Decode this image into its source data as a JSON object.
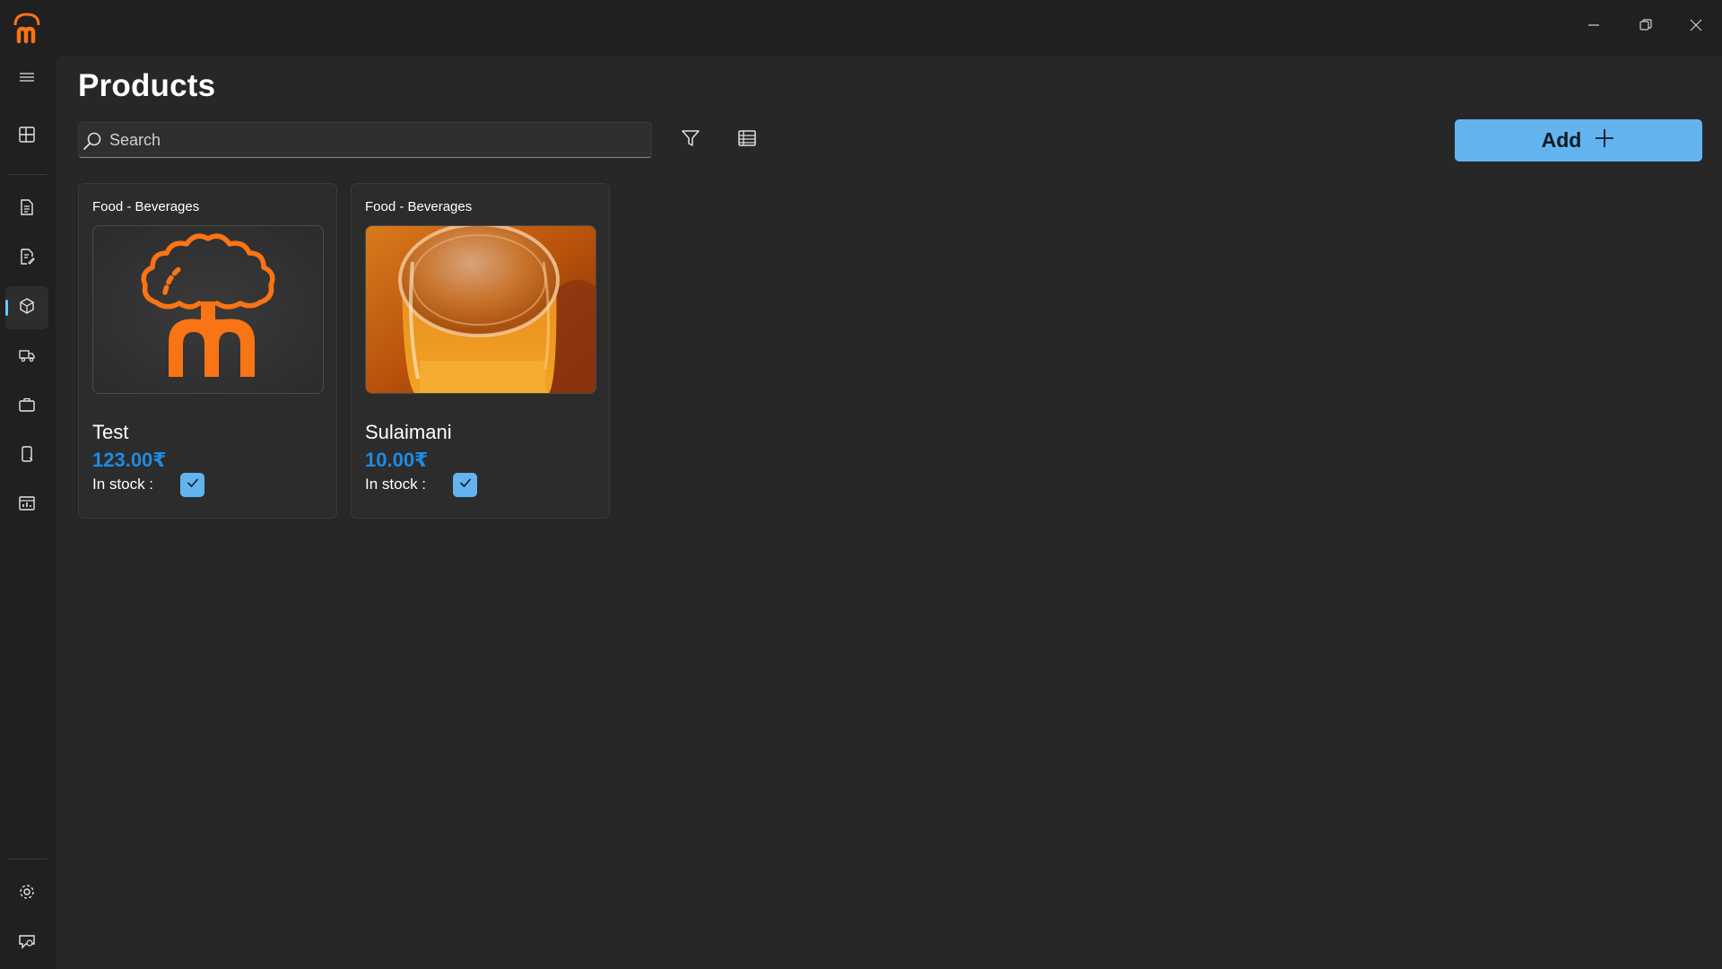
{
  "window": {
    "logo": "app-logo-icon",
    "controls": [
      "minimize-icon",
      "restore-icon",
      "close-icon"
    ]
  },
  "sidebar": {
    "items": [
      {
        "icon": "hamburger-menu-icon"
      },
      {
        "icon": "dashboard-icon"
      },
      {
        "icon": "document-icon"
      },
      {
        "icon": "document-edit-icon"
      },
      {
        "icon": "box-icon",
        "active": true
      },
      {
        "icon": "delivery-truck-icon"
      },
      {
        "icon": "briefcase-icon"
      },
      {
        "icon": "phone-icon"
      },
      {
        "icon": "report-icon"
      },
      {
        "icon": "settings-icon"
      },
      {
        "icon": "feedback-icon"
      }
    ]
  },
  "header": {
    "title": "Products"
  },
  "search": {
    "placeholder": "Search",
    "value": ""
  },
  "toolbar": {
    "filter_icon": "filter-icon",
    "table_view_icon": "table-view-icon",
    "add_label": "Add"
  },
  "products": [
    {
      "category": "Food - Beverages",
      "name": "Test",
      "price": "123.00₹",
      "stock_label": "In stock :",
      "in_stock": true,
      "image": "brand-logo-image"
    },
    {
      "category": "Food - Beverages",
      "name": "Sulaimani",
      "price": "10.00₹",
      "stock_label": "In stock :",
      "in_stock": true,
      "image": "tea-glass-photo"
    }
  ],
  "colors": {
    "accent": "#63b4ee",
    "price": "#1f8be3",
    "brand_orange": "#f97414",
    "background": "#272727"
  }
}
